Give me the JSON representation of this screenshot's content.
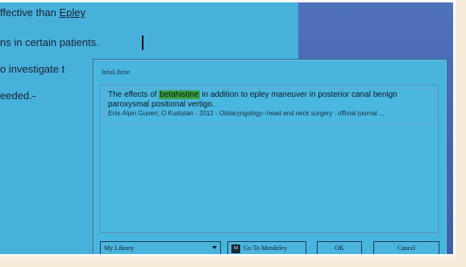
{
  "document": {
    "lines": [
      {
        "prefix": "ffective than ",
        "highlight": "Epley"
      },
      {
        "prefix": "ns in certain patients.",
        "highlight": ""
      },
      {
        "prefix": "o investigate t",
        "highlight": ""
      },
      {
        "prefix": "eeded.-",
        "highlight": ""
      }
    ]
  },
  "dialog": {
    "title": "InfoLibrite",
    "result": {
      "title_before": "The effects of ",
      "title_match": "betahistine",
      "title_after": " in addition to epley maneuver in posterior canal benign paroxysmal positional vertigo.",
      "meta": "Enis Alpin Guneri; O Kustutan - 2012 - Otolaryngology--head and neck surgery : official journal ..."
    },
    "library_select": "My Library",
    "goto_button": "Go To Mendeley",
    "ok_button": "OK",
    "cancel_button": "Cancel",
    "mendeley_icon_text": "M"
  },
  "colors": {
    "document_bg": "#47b1dc",
    "dialog_bg": "#48b5df",
    "desktop_bg": "#3f5fae",
    "match_highlight": "#3aa045"
  }
}
